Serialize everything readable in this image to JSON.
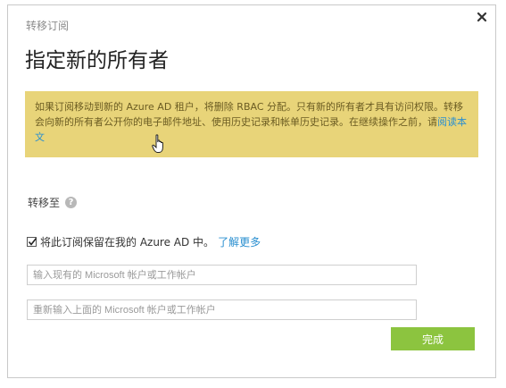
{
  "dialog": {
    "eyebrow": "转移订阅",
    "title": "指定新的所有者",
    "warning": {
      "text": "如果订阅移动到新的 Azure AD 租户，将删除 RBAC 分配。只有新的所有者才具有访问权限。转移会向新的所有者公开你的电子邮件地址、使用历史记录和帐单历史记录。在继续操作之前，请",
      "link": "阅读本文"
    },
    "transfer_to_label": "转移至",
    "help_icon": "?",
    "keep_in_ad": {
      "checked": true,
      "label": "将此订阅保留在我的 Azure AD 中。",
      "link": "了解更多"
    },
    "account_input": {
      "placeholder": "输入现有的 Microsoft 帐户或工作帐户",
      "value": ""
    },
    "confirm_input": {
      "placeholder": "重新输入上面的 Microsoft 帐户或工作帐户",
      "value": ""
    },
    "done_label": "完成"
  },
  "colors": {
    "warning_bg": "#e8d479",
    "link": "#2a8fd0",
    "done_button": "#8cc43f"
  }
}
